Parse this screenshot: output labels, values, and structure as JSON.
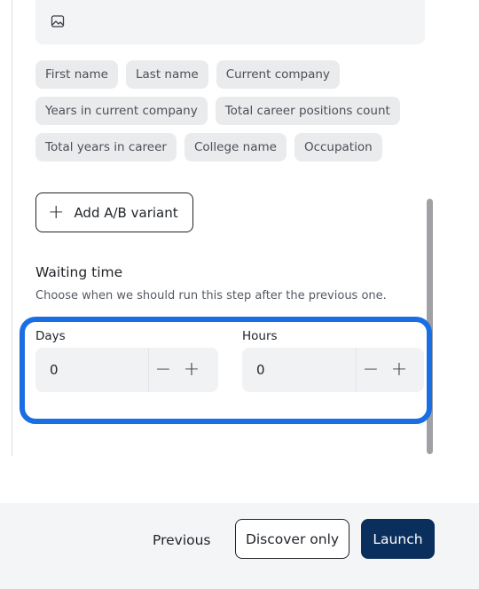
{
  "editor": {
    "icon": "image-icon"
  },
  "variables": {
    "rows": [
      [
        "First name",
        "Last name",
        "Current company"
      ],
      [
        "Years in current company",
        "Total career positions count"
      ],
      [
        "Total years in career",
        "College name",
        "Occupation"
      ]
    ]
  },
  "ab_variant": {
    "icon": "plus-icon",
    "label": "Add A/B variant"
  },
  "waiting_time": {
    "title": "Waiting time",
    "description": "Choose when we should run this step after the previous one.",
    "days": {
      "label": "Days",
      "value": "0",
      "decrement": "−",
      "increment": "+"
    },
    "hours": {
      "label": "Hours",
      "value": "0",
      "decrement": "−",
      "increment": "+"
    },
    "highlight_color": "#1a6ee3"
  },
  "footer": {
    "previous_label": "Previous",
    "discover_label": "Discover only",
    "launch_label": "Launch",
    "launch_color": "#0b2f5c"
  }
}
